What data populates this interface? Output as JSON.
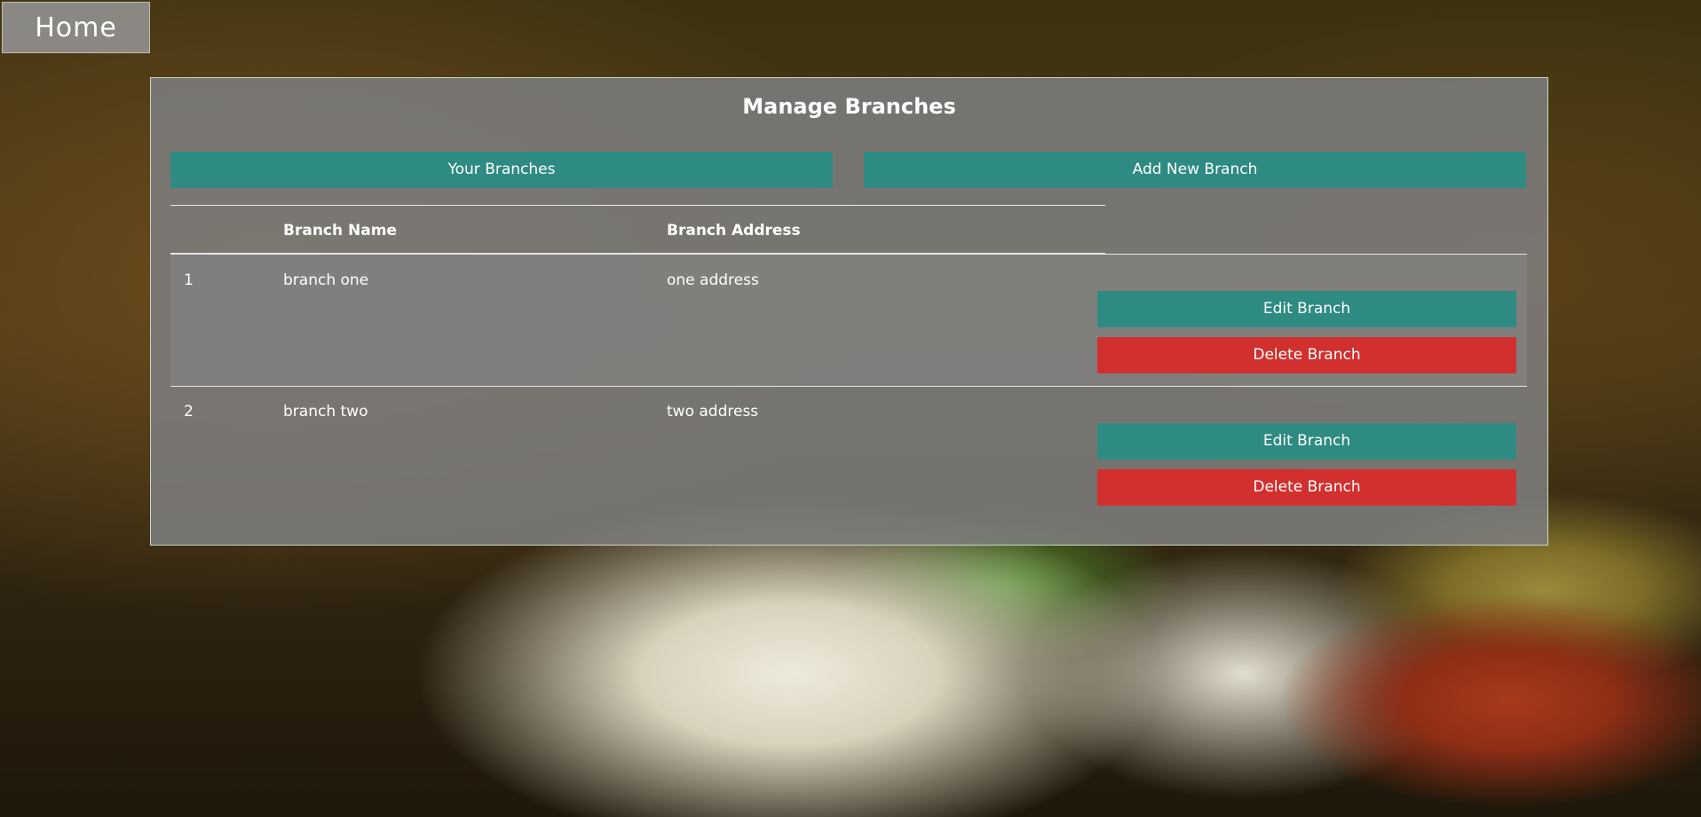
{
  "nav": {
    "home_label": "Home"
  },
  "panel": {
    "title": "Manage Branches",
    "tabs": [
      {
        "label": "Your Branches"
      },
      {
        "label": "Add New Branch"
      }
    ]
  },
  "table": {
    "headers": [
      "",
      "Branch Name",
      "Branch Address"
    ],
    "rows": [
      {
        "index": "1",
        "name": "branch one",
        "address": "one address",
        "edit_label": "Edit Branch",
        "delete_label": "Delete Branch"
      },
      {
        "index": "2",
        "name": "branch two",
        "address": "two address",
        "edit_label": "Edit Branch",
        "delete_label": "Delete Branch"
      }
    ]
  },
  "colors": {
    "accent_teal": "#2e8b82",
    "danger_red": "#d1302e",
    "panel_bg": "#7d7d7d"
  }
}
